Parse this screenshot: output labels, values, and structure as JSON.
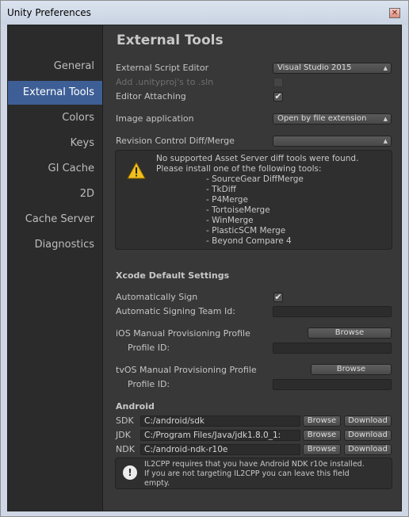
{
  "window": {
    "title": "Unity Preferences",
    "close_glyph": "✕"
  },
  "sidebar": {
    "items": [
      {
        "label": "General"
      },
      {
        "label": "External Tools"
      },
      {
        "label": "Colors"
      },
      {
        "label": "Keys"
      },
      {
        "label": "GI Cache"
      },
      {
        "label": "2D"
      },
      {
        "label": "Cache Server"
      },
      {
        "label": "Diagnostics"
      }
    ],
    "active": "External Tools"
  },
  "main": {
    "title": "External Tools",
    "external_script_editor": {
      "label": "External Script Editor",
      "value": "Visual Studio 2015"
    },
    "add_unityproj": {
      "label": "Add .unityproj's to .sln",
      "checked": false
    },
    "editor_attaching": {
      "label": "Editor Attaching",
      "checked": true,
      "mark": "✔"
    },
    "image_application": {
      "label": "Image application",
      "value": "Open by file extension"
    },
    "revision_control": {
      "label": "Revision Control Diff/Merge",
      "value": ""
    },
    "diff_warning": {
      "line1": "No supported Asset Server diff tools were found.",
      "line2": "Please install one of the following tools:",
      "tools": [
        "- SourceGear DiffMerge",
        "- TkDiff",
        "- P4Merge",
        "- TortoiseMerge",
        "- WinMerge",
        "- PlasticSCM Merge",
        "- Beyond Compare 4"
      ]
    },
    "xcode": {
      "heading": "Xcode Default Settings",
      "auto_sign": {
        "label": "Automatically Sign",
        "checked": true,
        "mark": "✔"
      },
      "team_id": {
        "label": "Automatic Signing Team Id:",
        "value": ""
      },
      "ios_profile": {
        "label": "iOS Manual Provisioning Profile",
        "button": "Browse"
      },
      "ios_profile_id": {
        "label": "Profile ID:",
        "value": ""
      },
      "tvos_profile": {
        "label": "tvOS Manual Provisioning Profile",
        "button": "Browse"
      },
      "tvos_profile_id": {
        "label": "Profile ID:",
        "value": ""
      }
    },
    "android": {
      "heading": "Android",
      "sdk": {
        "label": "SDK",
        "path": "C:/android/sdk",
        "browse": "Browse",
        "download": "Download"
      },
      "jdk": {
        "label": "JDK",
        "path": "C:/Program Files/Java/jdk1.8.0_1:",
        "browse": "Browse",
        "download": "Download"
      },
      "ndk": {
        "label": "NDK",
        "path": "C:/android-ndk-r10e",
        "browse": "Browse",
        "download": "Download"
      },
      "info_icon": "!",
      "info": {
        "line1": "IL2CPP requires that you have Android NDK r10e installed.",
        "line2": "If you are not targeting IL2CPP you can leave this field",
        "line3": "empty."
      }
    }
  },
  "colors": {
    "active_tab": "#3e5f96",
    "panel_bg": "#383838",
    "sidebar_bg": "#2b2b2b"
  }
}
